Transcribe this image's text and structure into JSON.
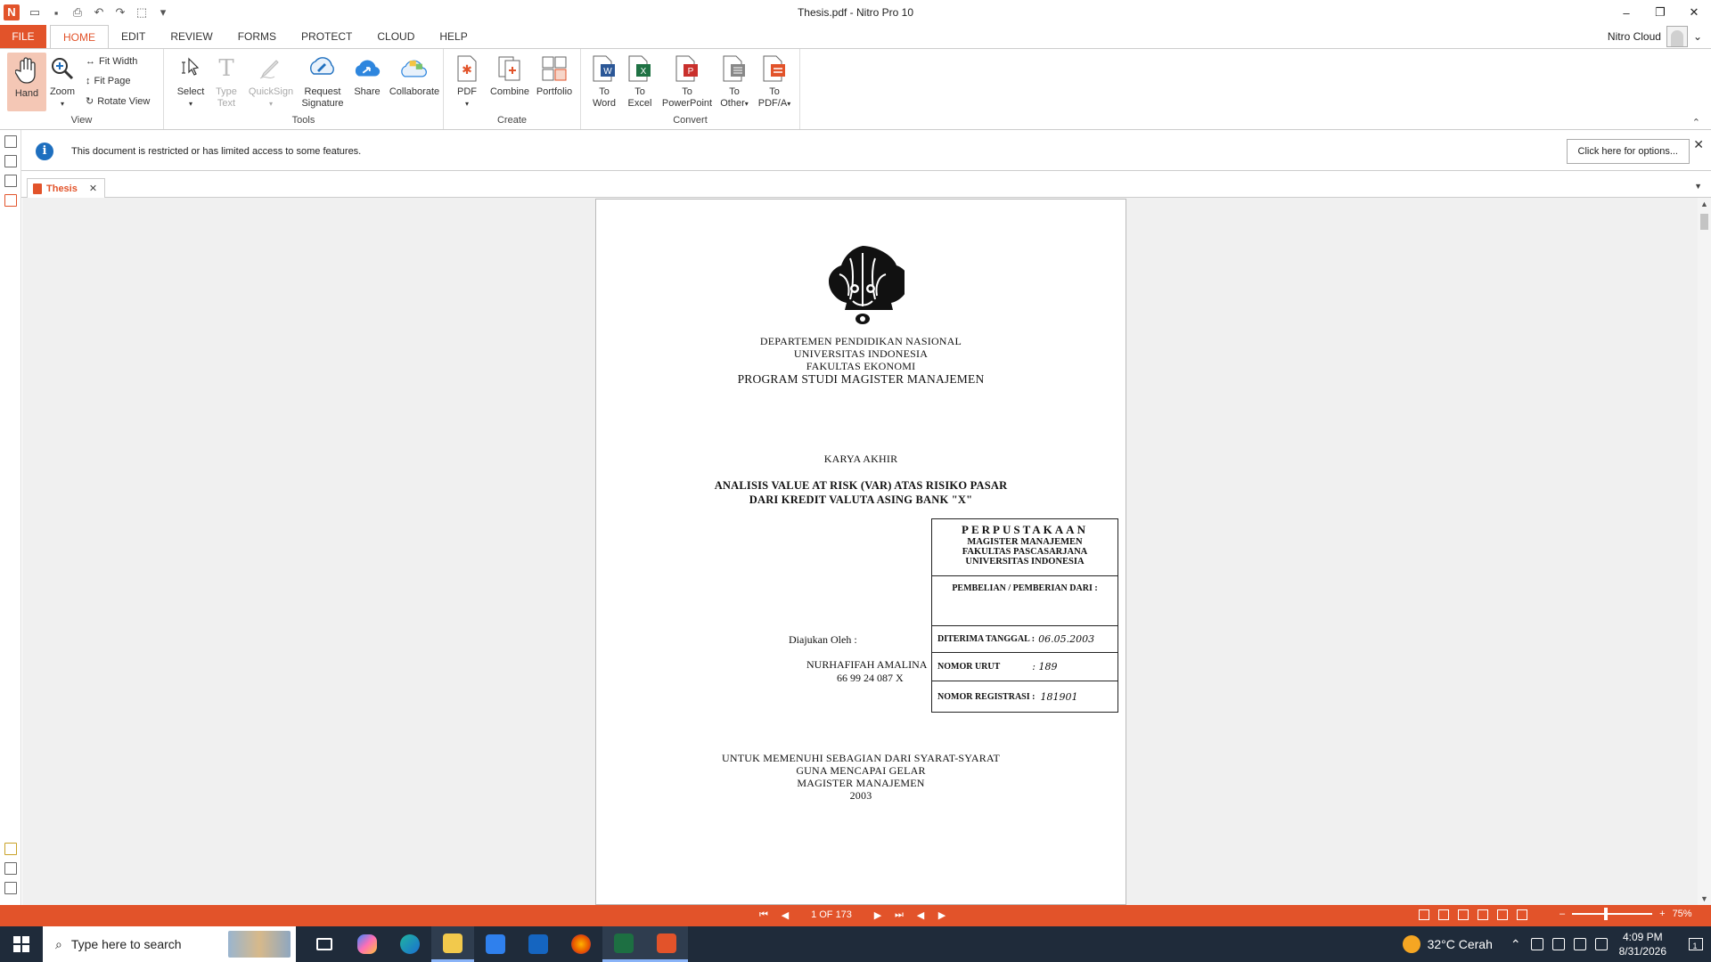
{
  "window": {
    "title": "Thesis.pdf - Nitro Pro 10",
    "app_logo_glyph": "N",
    "qat_icons": [
      "folder-open-icon",
      "save-icon",
      "print-icon",
      "undo-icon",
      "redo-icon",
      "select-icon",
      "customize-icon"
    ],
    "controls": {
      "minimize": "–",
      "restore": "❐",
      "close": "✕"
    }
  },
  "menu": {
    "file": "FILE",
    "tabs": [
      "HOME",
      "EDIT",
      "REVIEW",
      "FORMS",
      "PROTECT",
      "CLOUD",
      "HELP"
    ],
    "active_tab": "HOME",
    "account": "Nitro Cloud"
  },
  "ribbon": {
    "view": {
      "label": "View",
      "hand": "Hand",
      "zoom": "Zoom",
      "fit_width": "Fit Width",
      "fit_page": "Fit Page",
      "rotate_view": "Rotate View"
    },
    "tools": {
      "label": "Tools",
      "select": "Select",
      "type_text_1": "Type",
      "type_text_2": "Text",
      "quicksign": "QuickSign",
      "request_signature_1": "Request",
      "request_signature_2": "Signature",
      "share": "Share",
      "collaborate": "Collaborate"
    },
    "create": {
      "label": "Create",
      "pdf": "PDF",
      "combine": "Combine",
      "portfolio": "Portfolio"
    },
    "convert": {
      "label": "Convert",
      "to_word_1": "To",
      "to_word_2": "Word",
      "to_excel_1": "To",
      "to_excel_2": "Excel",
      "to_ppt_1": "To",
      "to_ppt_2": "PowerPoint",
      "to_other_1": "To",
      "to_other_2": "Other",
      "to_pdfa_1": "To",
      "to_pdfa_2": "PDF/A"
    }
  },
  "infobar": {
    "message": "This document is restricted or has limited access to some features.",
    "button": "Click here for options..."
  },
  "doc_tab": {
    "label": "Thesis"
  },
  "document": {
    "dept": "DEPARTEMEN PENDIDIKAN NASIONAL",
    "univ": "UNIVERSITAS INDONESIA",
    "faculty": "FAKULTAS EKONOMI",
    "program": "PROGRAM STUDI MAGISTER MANAJEMEN",
    "type": "KARYA AKHIR",
    "title_1": "ANALISIS VALUE AT RISK (VAR) ATAS RISIKO PASAR",
    "title_2": "DARI KREDIT VALUTA ASING BANK \"X\"",
    "submitted_by": "Diajukan Oleh :",
    "author": "NURHAFIFAH AMALINA",
    "student_id": "66 99 24 087 X",
    "purpose_1": "UNTUK MEMENUHI SEBAGIAN DARI SYARAT-SYARAT",
    "purpose_2": "GUNA MENCAPAI GELAR",
    "purpose_3": "MAGISTER MANAJEMEN",
    "year": "2003",
    "stamp": {
      "h1": "PERPUSTAKAAN",
      "h2": "MAGISTER MANAJEMEN",
      "h3": "FAKULTAS PASCASARJANA",
      "h4": "UNIVERSITAS INDONESIA",
      "pembelian": "PEMBELIAN / PEMBERIAN DARI :",
      "diterima_label": "DITERIMA TANGGAL :",
      "diterima_value": "06.05.2003",
      "nomor_urut_label": "NOMOR URUT",
      "nomor_urut_value": ": 189",
      "registrasi_label": "NOMOR REGISTRASI :",
      "registrasi_value": "181901"
    }
  },
  "status": {
    "page_indicator": "1 OF 173",
    "zoom": "75%",
    "zoom_level": 0.4
  },
  "taskbar": {
    "search_placeholder": "Type here to search",
    "weather": "32°C  Cerah",
    "time": "4:09 PM",
    "date": "8/31/2026",
    "apps": [
      "task-view-icon",
      "copilot-icon",
      "edge-icon",
      "file-explorer-icon",
      "store-icon",
      "outlook-icon",
      "firefox-icon",
      "excel-icon",
      "nitro-icon"
    ],
    "notification_count": "1"
  },
  "colors": {
    "accent": "#e2532a",
    "info_blue": "#1e6fbf",
    "taskbar": "#1f2b3a"
  }
}
